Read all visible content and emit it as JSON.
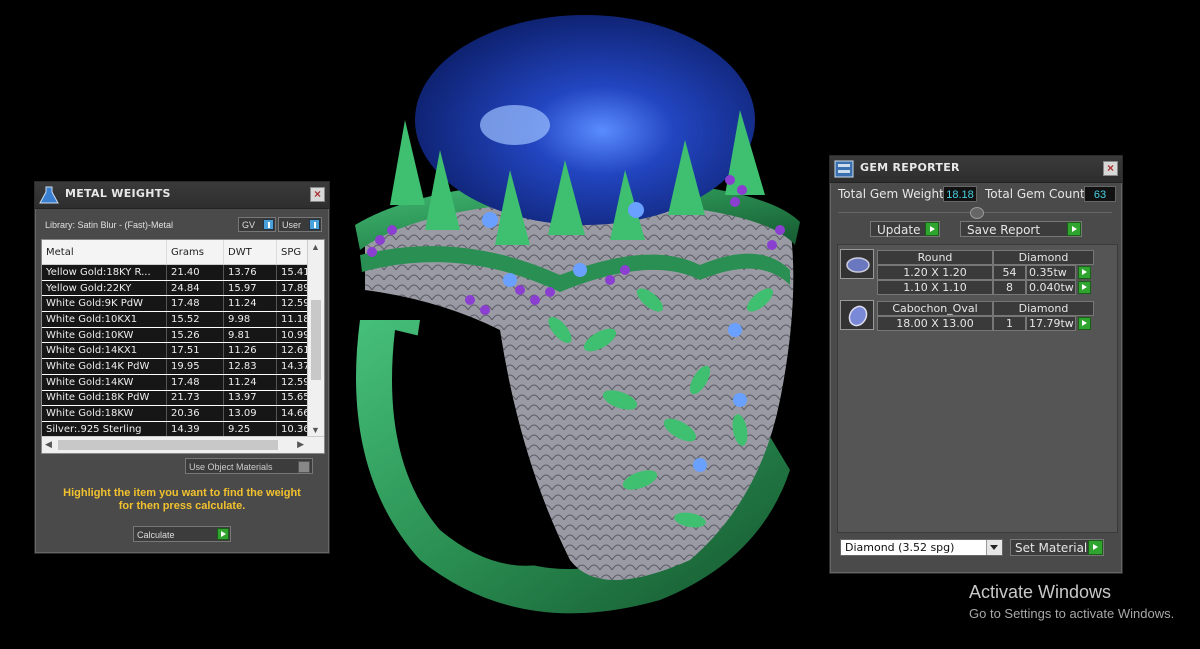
{
  "metal_weights": {
    "title": "METAL WEIGHTS",
    "library_label": "Library: Satin Blur - (Fast)-Metal",
    "gv_label": "GV",
    "user_label": "User",
    "columns": [
      "Metal",
      "Grams",
      "DWT",
      "SPG"
    ],
    "rows": [
      [
        "Yellow Gold:18KY R...",
        "21.40",
        "13.76",
        "15.41"
      ],
      [
        "Yellow Gold:22KY",
        "24.84",
        "15.97",
        "17.89"
      ],
      [
        "White Gold:9K PdW",
        "17.48",
        "11.24",
        "12.59"
      ],
      [
        "White Gold:10KX1",
        "15.52",
        "9.98",
        "11.18"
      ],
      [
        "White Gold:10KW",
        "15.26",
        "9.81",
        "10.99"
      ],
      [
        "White Gold:14KX1",
        "17.51",
        "11.26",
        "12.61"
      ],
      [
        "White Gold:14K PdW",
        "19.95",
        "12.83",
        "14.37"
      ],
      [
        "White Gold:14KW",
        "17.48",
        "11.24",
        "12.59"
      ],
      [
        "White Gold:18K PdW",
        "21.73",
        "13.97",
        "15.65"
      ],
      [
        "White Gold:18KW",
        "20.36",
        "13.09",
        "14.66"
      ],
      [
        "Silver:.925 Sterling",
        "14.39",
        "9.25",
        "10.36"
      ]
    ],
    "use_object_materials": "Use Object Materials",
    "hint_line1": "Highlight the item you want to find the weight",
    "hint_line2": "for then press calculate.",
    "calculate_label": "Calculate"
  },
  "gem_reporter": {
    "title": "GEM REPORTER",
    "total_weight_label": "Total Gem Weight",
    "total_weight_value": "18.18",
    "total_count_label": "Total Gem Count",
    "total_count_value": "63",
    "update_label": "Update",
    "save_report_label": "Save Report",
    "gems": [
      {
        "shape": "Round",
        "material": "Diamond",
        "sizes": [
          {
            "size": "1.20 X 1.20",
            "count": "54",
            "weight": "0.35tw"
          },
          {
            "size": "1.10 X 1.10",
            "count": "8",
            "weight": "0.040tw"
          }
        ]
      },
      {
        "shape": "Cabochon_Oval",
        "material": "Diamond",
        "sizes": [
          {
            "size": "18.00 X 13.00",
            "count": "1",
            "weight": "17.79tw"
          }
        ]
      }
    ],
    "material_select_value": "Diamond      (3.52 spg)",
    "set_material_label": "Set Material"
  },
  "watermark": {
    "line1": "Activate Windows",
    "line2": "Go to Settings to activate Windows."
  },
  "colors": {
    "ring_green": "#2f9a5a",
    "stone_blue": "#1e3a9a",
    "accent_yellow": "#f2c12e",
    "value_cyan": "#48d0e0",
    "button_green": "#2fa52f"
  }
}
